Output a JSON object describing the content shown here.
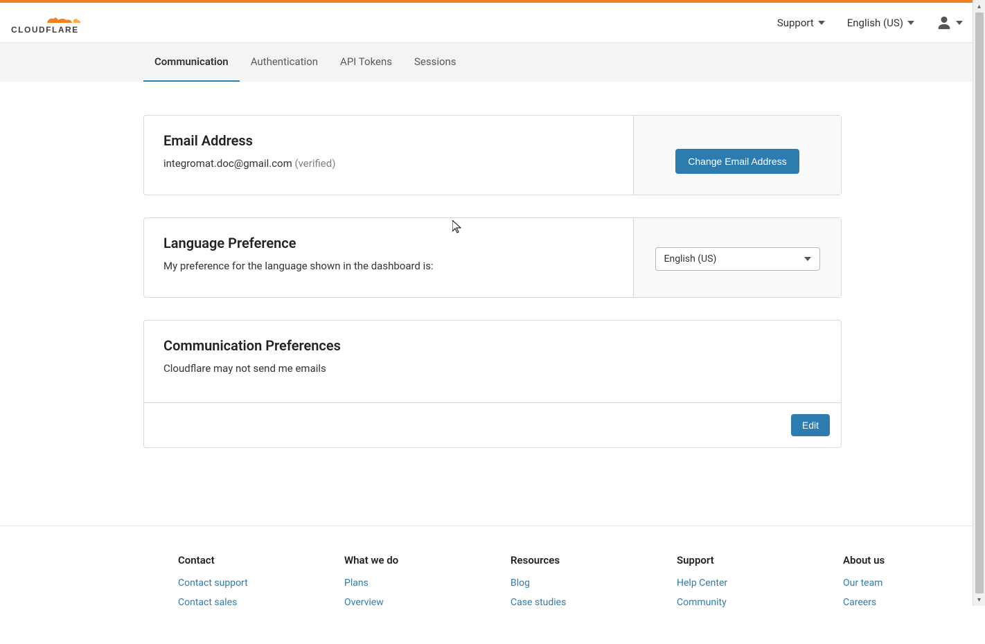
{
  "brand": "CLOUDFLARE",
  "header": {
    "support": "Support",
    "language": "English (US)"
  },
  "tabs": [
    "Communication",
    "Authentication",
    "API Tokens",
    "Sessions"
  ],
  "email_card": {
    "title": "Email Address",
    "email": "integromat.doc@gmail.com",
    "status": "(verified)",
    "button": "Change Email Address"
  },
  "language_card": {
    "title": "Language Preference",
    "text": "My preference for the language shown in the dashboard is:",
    "selected": "English (US)"
  },
  "comm_card": {
    "title": "Communication Preferences",
    "text": "Cloudflare may not send me emails",
    "edit": "Edit"
  },
  "footer": {
    "cols": [
      {
        "title": "Contact",
        "links": [
          "Contact support",
          "Contact sales"
        ]
      },
      {
        "title": "What we do",
        "links": [
          "Plans",
          "Overview"
        ]
      },
      {
        "title": "Resources",
        "links": [
          "Blog",
          "Case studies"
        ]
      },
      {
        "title": "Support",
        "links": [
          "Help Center",
          "Community"
        ]
      },
      {
        "title": "About us",
        "links": [
          "Our team",
          "Careers"
        ]
      }
    ]
  }
}
